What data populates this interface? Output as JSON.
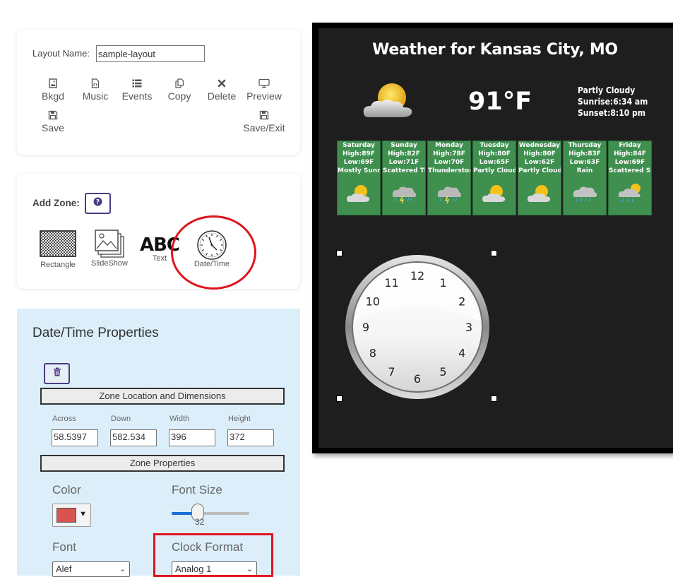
{
  "layout": {
    "name_label": "Layout Name:",
    "name_value": "sample-layout",
    "toolbar": [
      {
        "label": "Bkgd",
        "icon": "image-icon"
      },
      {
        "label": "Music",
        "icon": "music-file-icon"
      },
      {
        "label": "Events",
        "icon": "list-icon"
      },
      {
        "label": "Copy",
        "icon": "copy-icon"
      },
      {
        "label": "Delete",
        "icon": "close-icon"
      },
      {
        "label": "Preview",
        "icon": "monitor-icon"
      },
      {
        "label": "Save",
        "icon": "save-icon"
      },
      {
        "label": "Save/Exit",
        "icon": "save-icon"
      }
    ]
  },
  "add_zone": {
    "label": "Add Zone:",
    "help_icon": "question-circle-icon",
    "items": [
      {
        "label": "Rectangle",
        "icon": "dotted-rectangle-icon"
      },
      {
        "label": "SlideShow",
        "icon": "slideshow-icon"
      },
      {
        "label": "Text",
        "icon": "text-abc-icon"
      },
      {
        "label": "Date/Time",
        "icon": "clock-icon"
      }
    ]
  },
  "properties": {
    "title": "Date/Time Properties",
    "trash_icon": "trash-icon",
    "section_location": "Zone Location and Dimensions",
    "fields": [
      {
        "label": "Across",
        "value": "58.5397"
      },
      {
        "label": "Down",
        "value": "582.534"
      },
      {
        "label": "Width",
        "value": "396"
      },
      {
        "label": "Height",
        "value": "372"
      }
    ],
    "section_zone": "Zone Properties",
    "color_label": "Color",
    "color_value": "#d9534f",
    "font_size_label": "Font Size",
    "font_size_value": "32",
    "font_size_fraction": 0.34,
    "font_label": "Font",
    "font_value": "Alef",
    "clock_format_label": "Clock Format",
    "clock_format_value": "Analog 1"
  },
  "canvas": {
    "title": "Weather for Kansas City, MO",
    "temperature": "91°F",
    "condition": "Partly Cloudy",
    "sunrise": "Sunrise:6:34 am",
    "sunset": "Sunset:8:10 pm",
    "forecast": [
      {
        "day": "Saturday",
        "high": "High:89F",
        "low": "Low:69F",
        "cond": "Mostly Sunny",
        "icon": "sun-cloud-icon"
      },
      {
        "day": "Sunday",
        "high": "High:82F",
        "low": "Low:71F",
        "cond": "Scattered Thu",
        "icon": "storm-icon"
      },
      {
        "day": "Monday",
        "high": "High:78F",
        "low": "Low:70F",
        "cond": "Thunderstorms",
        "icon": "storm-icon"
      },
      {
        "day": "Tuesday",
        "high": "High:80F",
        "low": "Low:65F",
        "cond": "Partly Cloudy",
        "icon": "sun-cloud-icon"
      },
      {
        "day": "Wednesday",
        "high": "High:80F",
        "low": "Low:62F",
        "cond": "Partly Cloudy",
        "icon": "sun-cloud-icon"
      },
      {
        "day": "Thursday",
        "high": "High:83F",
        "low": "Low:63F",
        "cond": "Rain",
        "icon": "rain-icon"
      },
      {
        "day": "Friday",
        "high": "High:84F",
        "low": "Low:69F",
        "cond": "Scattered Sho",
        "icon": "sun-rain-icon"
      }
    ],
    "clock_numbers": [
      "12",
      "1",
      "2",
      "3",
      "4",
      "5",
      "6",
      "7",
      "8",
      "9",
      "10",
      "11"
    ],
    "colors": {
      "canvas_bg": "#1e1e1e",
      "tile_green": "#3f8f4f",
      "highlight_red": "#e0141e",
      "accent_purple": "#4b3a87"
    }
  }
}
